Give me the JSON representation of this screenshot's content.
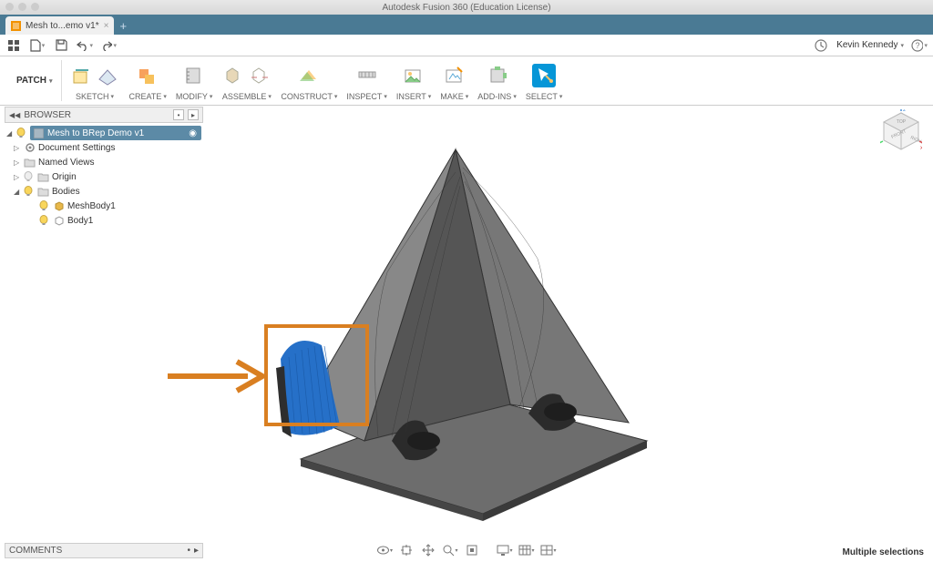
{
  "title": "Autodesk Fusion 360 (Education License)",
  "tab": {
    "label": "Mesh to...emo v1*"
  },
  "user": {
    "name": "Kevin Kennedy"
  },
  "workspace": "PATCH",
  "ribbon": {
    "sketch": "SKETCH",
    "create": "CREATE",
    "modify": "MODIFY",
    "assemble": "ASSEMBLE",
    "construct": "CONSTRUCT",
    "inspect": "INSPECT",
    "insert": "INSERT",
    "make": "MAKE",
    "addins": "ADD-INS",
    "select": "SELECT"
  },
  "browser": {
    "title": "BROWSER",
    "root": "Mesh to BRep Demo v1",
    "items": {
      "doc": "Document Settings",
      "views": "Named Views",
      "origin": "Origin",
      "bodies": "Bodies",
      "meshbody": "MeshBody1",
      "body1": "Body1"
    }
  },
  "comments": "COMMENTS",
  "status": "Multiple selections",
  "viewcube": {
    "front": "FRONT",
    "right": "RIGHT",
    "top": "TOP"
  }
}
